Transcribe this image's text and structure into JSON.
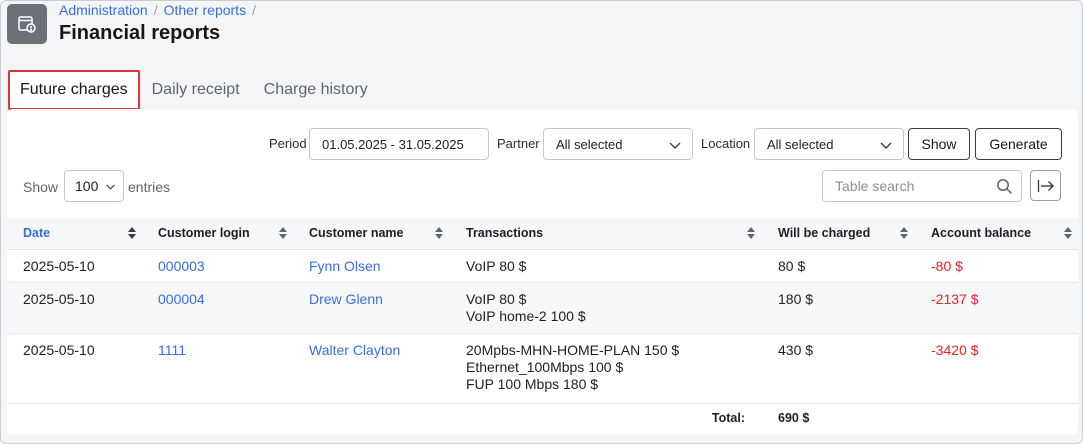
{
  "breadcrumb": {
    "item1": "Administration",
    "sep1": "/",
    "item2": "Other reports",
    "sep2": "/"
  },
  "page_title": "Financial reports",
  "tabs": [
    {
      "label": "Future charges",
      "active": true
    },
    {
      "label": "Daily receipt",
      "active": false
    },
    {
      "label": "Charge history",
      "active": false
    }
  ],
  "filters": {
    "period_label": "Period",
    "period_value": "01.05.2025 - 31.05.2025",
    "partner_label": "Partner",
    "partner_value": "All selected",
    "location_label": "Location",
    "location_value": "All selected",
    "show_button": "Show",
    "generate_button": "Generate"
  },
  "entries": {
    "prefix": "Show",
    "value": "100",
    "suffix": "entries"
  },
  "search": {
    "placeholder": "Table search"
  },
  "table": {
    "headers": {
      "date": "Date",
      "login": "Customer login",
      "name": "Customer name",
      "transactions": "Transactions",
      "charged": "Will be charged",
      "balance": "Account balance"
    },
    "rows": [
      {
        "date": "2025-05-10",
        "login": "000003",
        "name": "Fynn Olsen",
        "transactions": [
          "VoIP 80 $"
        ],
        "charged": "80 $",
        "balance": "-80 $"
      },
      {
        "date": "2025-05-10",
        "login": "000004",
        "name": "Drew Glenn",
        "transactions": [
          "VoIP 80 $",
          "VoIP home-2 100 $"
        ],
        "charged": "180 $",
        "balance": "-2137 $"
      },
      {
        "date": "2025-05-10",
        "login": "1111",
        "name": "Walter Clayton",
        "transactions": [
          "20Mpbs-MHN-HOME-PLAN 150 $",
          "Ethernet_100Mbps 100 $",
          "FUP 100 Mbps 180 $"
        ],
        "charged": "430 $",
        "balance": "-3420 $"
      }
    ],
    "footer": {
      "label": "Total:",
      "value": "690 $"
    }
  },
  "colors": {
    "accent": "#3b6fd6",
    "negative": "#e0242a",
    "active_tab_border": "#d4393b"
  }
}
